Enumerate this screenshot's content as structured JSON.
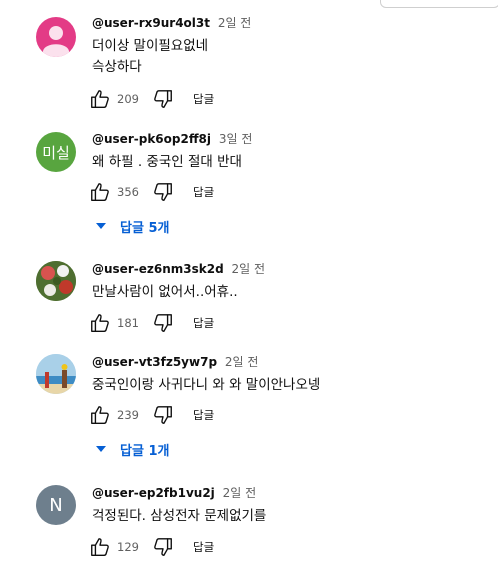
{
  "ui": {
    "reply_label": "답글"
  },
  "comments": [
    {
      "author": "@user-rx9ur4ol3t",
      "time": "2일 전",
      "lines": [
        "더이상 말이필요없네",
        "슥상하다"
      ],
      "likes": "209",
      "avatar": {
        "type": "default-person",
        "bg": "#e33b86"
      }
    },
    {
      "author": "@user-pk6op2ff8j",
      "time": "3일 전",
      "lines": [
        "왜 하필 . 중국인 절대 반대"
      ],
      "likes": "356",
      "avatar": {
        "type": "initial",
        "initial": "미실",
        "bg": "#58a53f"
      },
      "replies_label": "답글 5개"
    },
    {
      "author": "@user-ez6nm3sk2d",
      "time": "2일 전",
      "lines": [
        "만날사람이 없어서..어휴.."
      ],
      "likes": "181",
      "avatar": {
        "type": "photo-flowers",
        "bg": "#5a7a3a"
      }
    },
    {
      "author": "@user-vt3fz5yw7p",
      "time": "2일 전",
      "lines": [
        "중국인이랑 사귀다니 와 와 말이안나오넹"
      ],
      "likes": "239",
      "avatar": {
        "type": "photo-beach",
        "bg": "#a9d0e8"
      },
      "replies_label": "답글 1개"
    },
    {
      "author": "@user-ep2fb1vu2j",
      "time": "2일 전",
      "lines": [
        "걱정된다. 삼성전자 문제없기를"
      ],
      "likes": "129",
      "avatar": {
        "type": "initial",
        "initial": "N",
        "bg": "#6e7f8d"
      }
    }
  ]
}
